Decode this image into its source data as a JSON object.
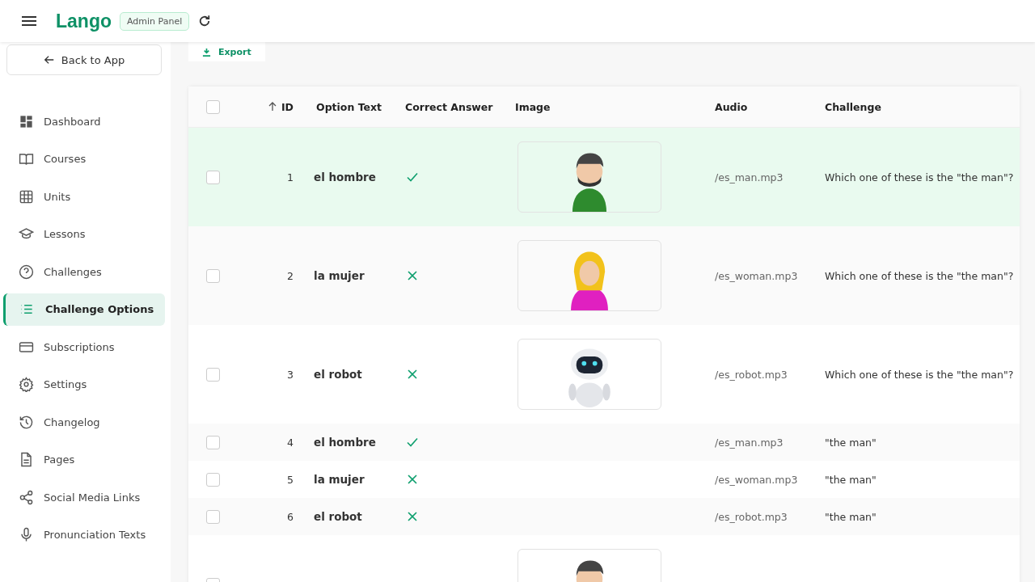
{
  "header": {
    "brand": "Lango",
    "badge": "Admin Panel"
  },
  "sidebar": {
    "back": "Back to App",
    "items": [
      {
        "label": "Dashboard",
        "selected": false
      },
      {
        "label": "Courses",
        "selected": false
      },
      {
        "label": "Units",
        "selected": false
      },
      {
        "label": "Lessons",
        "selected": false
      },
      {
        "label": "Challenges",
        "selected": false
      },
      {
        "label": "Challenge Options",
        "selected": true
      },
      {
        "label": "Subscriptions",
        "selected": false
      },
      {
        "label": "Settings",
        "selected": false
      },
      {
        "label": "Changelog",
        "selected": false
      },
      {
        "label": "Pages",
        "selected": false
      },
      {
        "label": "Social Media Links",
        "selected": false
      },
      {
        "label": "Pronunciation Texts",
        "selected": false
      }
    ]
  },
  "toolbar": {
    "export": "Export"
  },
  "table": {
    "select_all_checked": false,
    "columns": [
      "ID",
      "Option Text",
      "Correct Answer",
      "Image",
      "Audio",
      "Challenge"
    ],
    "rows": [
      {
        "checked": false,
        "highlighted": true,
        "id": "1",
        "text": "el hombre",
        "correct": true,
        "kind": "man",
        "audio": "/es_man.mp3",
        "challenge": "Which one of these is the \"the man\"?"
      },
      {
        "checked": false,
        "highlighted": false,
        "id": "2",
        "text": "la mujer",
        "correct": false,
        "kind": "woman",
        "audio": "/es_woman.mp3",
        "challenge": "Which one of these is the \"the man\"?"
      },
      {
        "checked": false,
        "highlighted": false,
        "id": "3",
        "text": "el robot",
        "correct": false,
        "kind": "robot",
        "audio": "/es_robot.mp3",
        "challenge": "Which one of these is the \"the man\"?"
      },
      {
        "checked": false,
        "highlighted": false,
        "id": "4",
        "text": "el hombre",
        "correct": true,
        "audio": "/es_man.mp3",
        "challenge": "\"the man\""
      },
      {
        "checked": false,
        "highlighted": false,
        "id": "5",
        "text": "la mujer",
        "correct": false,
        "audio": "/es_woman.mp3",
        "challenge": "\"the man\""
      },
      {
        "checked": false,
        "highlighted": false,
        "id": "6",
        "text": "el robot",
        "correct": false,
        "audio": "/es_robot.mp3",
        "challenge": "\"the man\""
      },
      {
        "checked": false,
        "highlighted": false,
        "kind": "man"
      }
    ]
  }
}
